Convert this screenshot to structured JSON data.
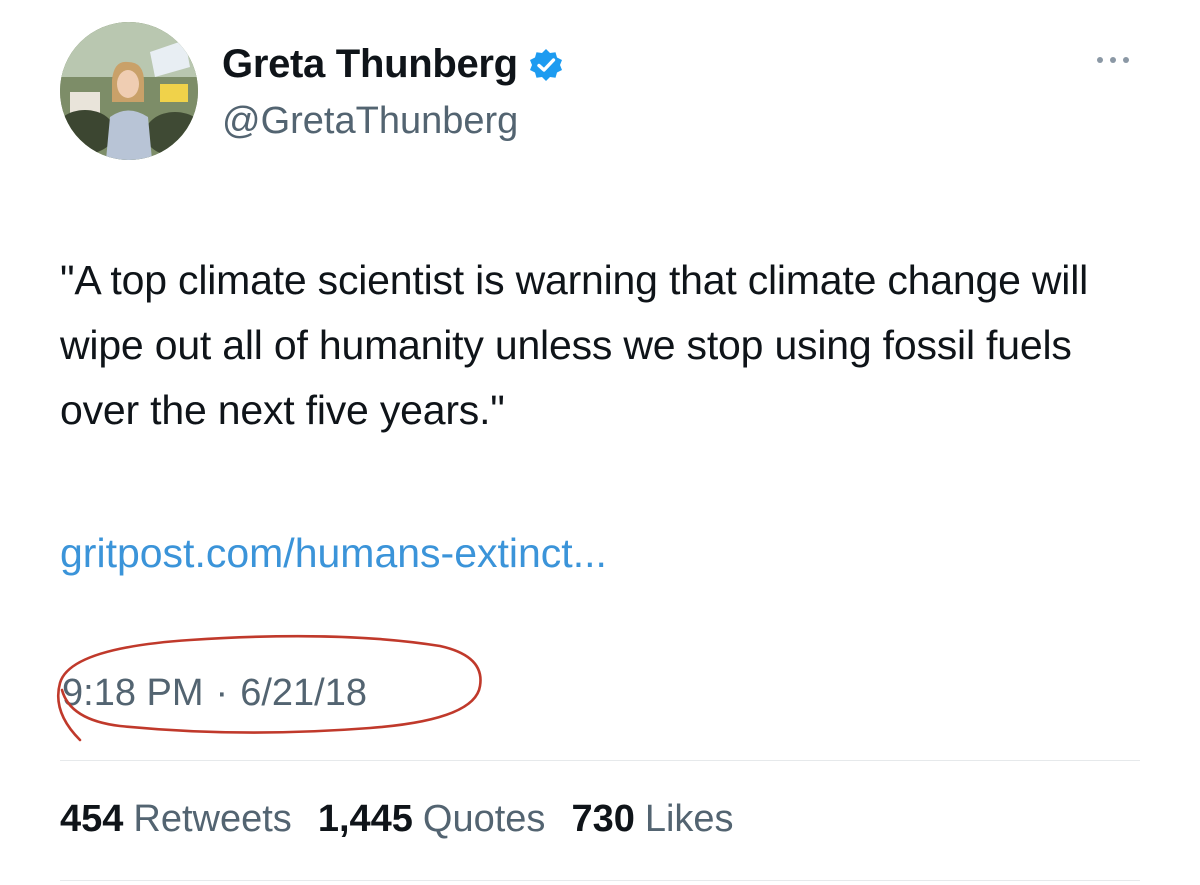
{
  "author": {
    "display_name": "Greta Thunberg",
    "handle": "@GretaThunberg",
    "verified": true
  },
  "tweet": {
    "text": "\"A top climate scientist is warning that climate change will wipe out all of humanity unless we stop using fossil fuels over the next five years.\"",
    "link": "gritpost.com/humans-extinct...",
    "time": "9:18 PM",
    "separator": "·",
    "date": "6/21/18"
  },
  "stats": [
    {
      "count": "454",
      "label": "Retweets"
    },
    {
      "count": "1,445",
      "label": "Quotes"
    },
    {
      "count": "730",
      "label": "Likes"
    }
  ],
  "colors": {
    "link": "#3b94d9",
    "verified": "#1d9bf0",
    "annotation": "#c0392b",
    "secondary_text": "#536471"
  },
  "icons": {
    "verified": "verified-badge-icon",
    "more": "more-options-icon"
  }
}
